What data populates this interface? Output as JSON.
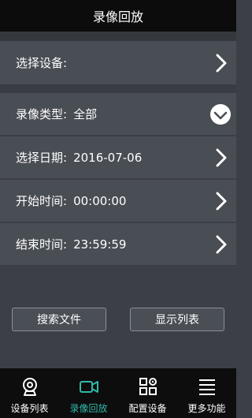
{
  "header": {
    "title": "录像回放"
  },
  "device_row": {
    "label": "选择设备:",
    "value": ""
  },
  "record_type_row": {
    "label": "录像类型:",
    "value": "全部"
  },
  "date_row": {
    "label": "选择日期:",
    "value": "2016-07-06"
  },
  "start_time_row": {
    "label": "开始时间:",
    "value": "00:00:00"
  },
  "end_time_row": {
    "label": "结束时间:",
    "value": "23:59:59"
  },
  "buttons": {
    "search": "搜索文件",
    "display_list": "显示列表"
  },
  "tabbar": {
    "active_color": "#2fb8a8",
    "tabs": [
      {
        "label": "设备列表",
        "icon": "camera-icon"
      },
      {
        "label": "录像回放",
        "icon": "video-icon"
      },
      {
        "label": "配置设备",
        "icon": "settings-grid-icon"
      },
      {
        "label": "更多功能",
        "icon": "menu-icon"
      }
    ]
  }
}
